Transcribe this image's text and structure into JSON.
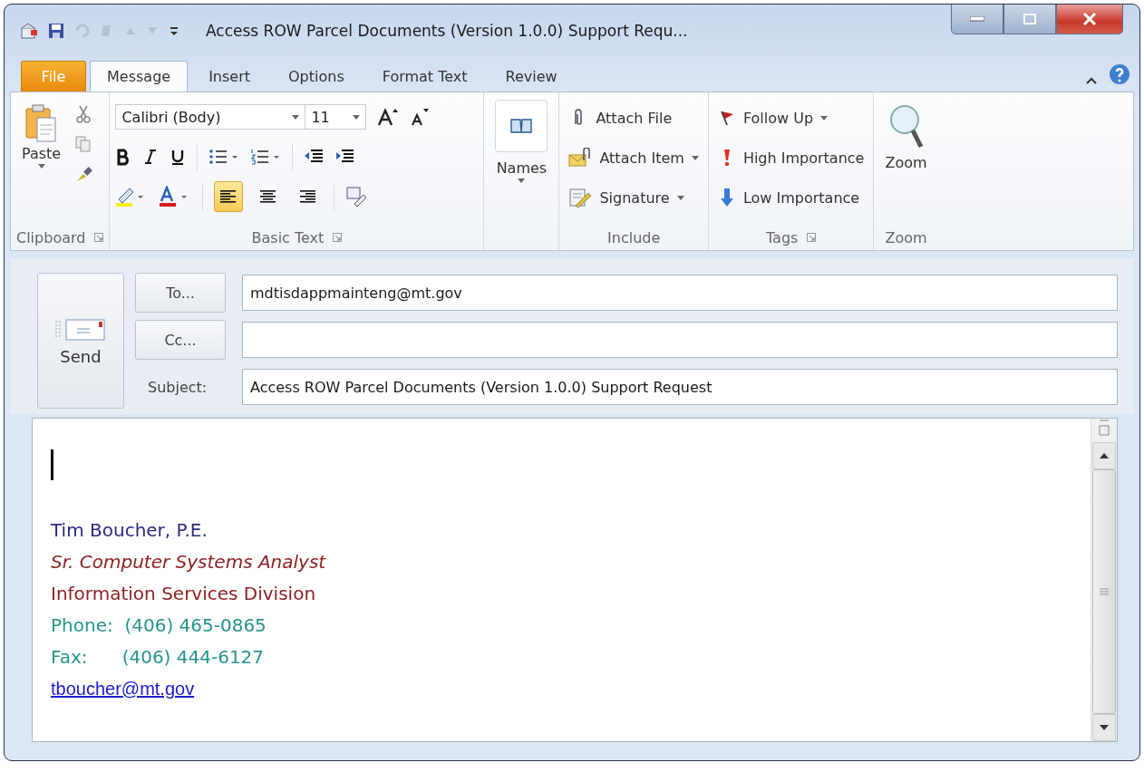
{
  "window": {
    "title": "Access ROW Parcel Documents (Version 1.0.0) Support Requ..."
  },
  "tabs": [
    {
      "label": "File",
      "kind": "file",
      "selected": false
    },
    {
      "label": "Message",
      "kind": "tab",
      "selected": true
    },
    {
      "label": "Insert",
      "kind": "tab",
      "selected": false
    },
    {
      "label": "Options",
      "kind": "tab",
      "selected": false
    },
    {
      "label": "Format Text",
      "kind": "tab",
      "selected": false
    },
    {
      "label": "Review",
      "kind": "tab",
      "selected": false
    }
  ],
  "ribbon": {
    "clipboard": {
      "paste": "Paste",
      "label": "Clipboard"
    },
    "basic_text": {
      "font": "Calibri (Body)",
      "size": "11",
      "label": "Basic Text",
      "alignment": [
        {
          "kind": "left",
          "selected": true
        },
        {
          "kind": "center",
          "selected": false
        },
        {
          "kind": "right",
          "selected": false
        }
      ]
    },
    "names": {
      "button": "Names"
    },
    "include": {
      "items": [
        {
          "kind": "attach-file",
          "label": "Attach File",
          "dropdown": false
        },
        {
          "kind": "attach-item",
          "label": "Attach Item",
          "dropdown": true
        },
        {
          "kind": "signature",
          "label": "Signature",
          "dropdown": true
        }
      ],
      "label": "Include"
    },
    "tags": {
      "items": [
        {
          "kind": "follow-up",
          "label": "Follow Up",
          "dropdown": true
        },
        {
          "kind": "high",
          "label": "High Importance",
          "dropdown": false
        },
        {
          "kind": "low",
          "label": "Low Importance",
          "dropdown": false
        }
      ],
      "label": "Tags"
    },
    "zoom": {
      "button": "Zoom",
      "label": "Zoom"
    }
  },
  "compose": {
    "send": "Send",
    "to_button": "To...",
    "to_value": "mdtisdappmainteng@mt.gov",
    "cc_button": "Cc...",
    "subject_label": "Subject:",
    "subject_value": "Access ROW Parcel Documents (Version 1.0.0) Support Request"
  },
  "signature": [
    {
      "kind": "text",
      "text": "Tim Boucher, P.E.",
      "color": "#2a2a80",
      "italic": false
    },
    {
      "kind": "text",
      "text": "Sr. Computer Systems Analyst",
      "color": "#8c1f1f",
      "italic": true
    },
    {
      "kind": "text",
      "text": "Information Services Division",
      "color": "#8c1f1f",
      "italic": false
    },
    {
      "kind": "text",
      "text": "Phone:  (406) 465-0865",
      "color": "#25968a",
      "italic": false
    },
    {
      "kind": "text",
      "text": "Fax:      (406) 444-6127",
      "color": "#25968a",
      "italic": false
    },
    {
      "kind": "link",
      "text": "tboucher@mt.gov",
      "color": "#1a1ad0",
      "italic": false
    }
  ]
}
